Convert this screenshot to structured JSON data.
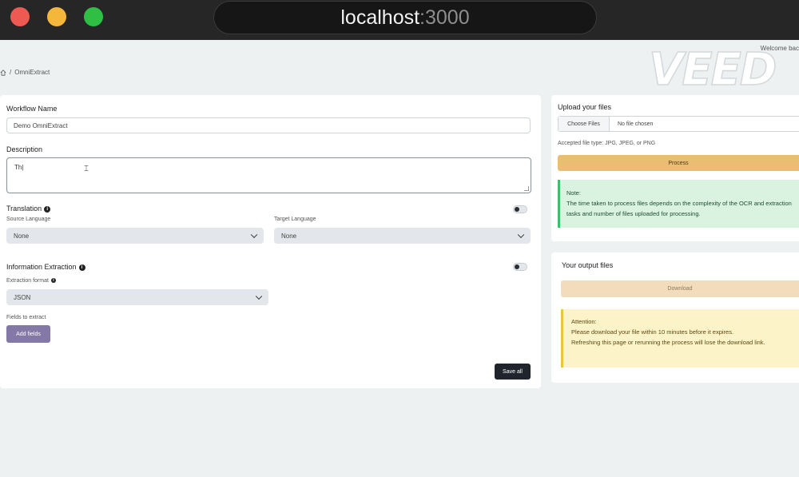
{
  "window": {
    "url_host": "localhost",
    "url_port": ":3000"
  },
  "header": {
    "welcome": "Welcome bac",
    "logo": "VEED",
    "breadcrumb_current": "OmniExtract",
    "breadcrumb_separator": "/"
  },
  "form": {
    "workflow_name_label": "Workflow Name",
    "workflow_name_value": "Demo OmniExtract",
    "description_label": "Description",
    "description_value": "Th|",
    "translation": {
      "label": "Translation",
      "enabled": false,
      "source_label": "Source Language",
      "source_value": "None",
      "target_label": "Target Language",
      "target_value": "None"
    },
    "extraction": {
      "label": "Information Extraction",
      "enabled": false,
      "format_label": "Extraction format",
      "format_value": "JSON",
      "fields_label": "Fields to extract",
      "add_fields_button": "Add fields"
    },
    "save_button": "Save all"
  },
  "upload": {
    "title": "Upload your files",
    "choose_button": "Choose Files",
    "no_file": "No file chosen",
    "accepted": "Accepted file type: JPG, JPEG, or PNG",
    "process_button": "Process",
    "note_title": "Note:",
    "note_text": "The time taken to process files depends on the complexity of the OCR and extraction tasks and number of files uploaded for processing."
  },
  "output": {
    "title": "Your output files",
    "download_button": "Download",
    "attention_title": "Attention:",
    "attention_line1": "Please download your file within 10 minutes before it expires.",
    "attention_line2": "Refreshing this page or rerunning the process will lose the download link."
  },
  "colors": {
    "process": "#ebbd72",
    "add_fields": "#8378a6",
    "save": "#1f252b",
    "note_border": "#3cbf6a",
    "attention_border": "#ecc63a"
  }
}
